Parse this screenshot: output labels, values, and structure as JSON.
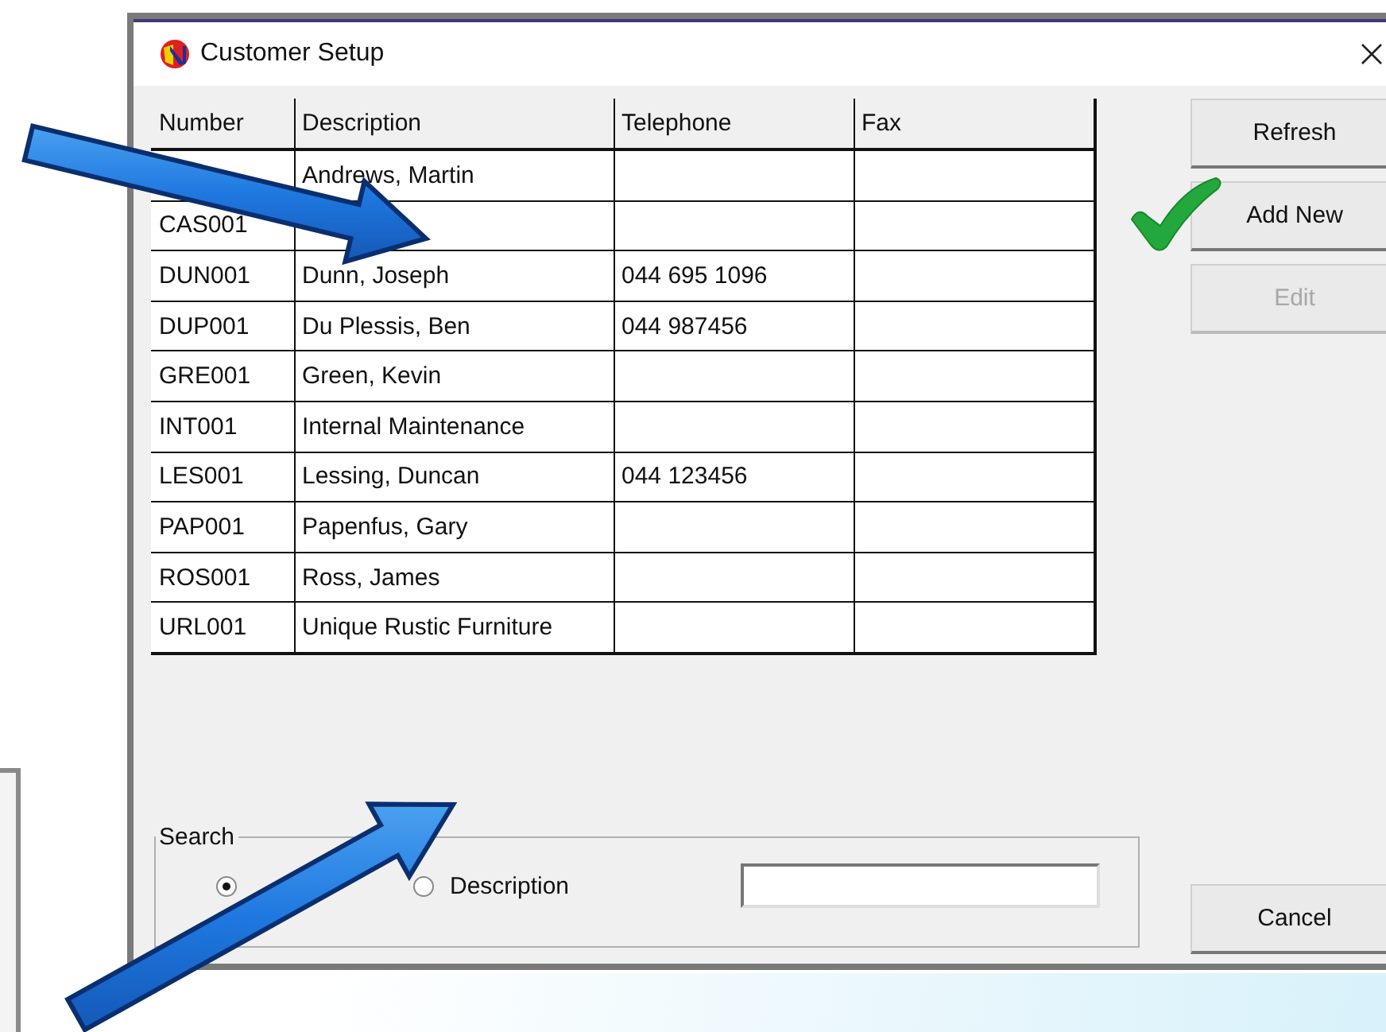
{
  "window": {
    "title": "Customer Setup"
  },
  "table": {
    "columns": [
      "Number",
      "Description",
      "Telephone",
      "Fax"
    ],
    "rows": [
      {
        "description": "Andrews, Martin"
      },
      {
        "number": "CAS001"
      },
      {
        "number": "DUN001",
        "description": "Dunn, Joseph",
        "telephone": "044 695 1096"
      },
      {
        "number": "DUP001",
        "description": "Du Plessis, Ben",
        "telephone": "044 987456"
      },
      {
        "number": "GRE001",
        "description": "Green, Kevin"
      },
      {
        "number": "INT001",
        "description": "Internal Maintenance"
      },
      {
        "number": "LES001",
        "description": "Lessing, Duncan",
        "telephone": "044 123456"
      },
      {
        "number": "PAP001",
        "description": "Papenfus, Gary"
      },
      {
        "number": "ROS001",
        "description": "Ross, James"
      },
      {
        "number": "URL001",
        "description": "Unique Rustic Furniture"
      }
    ]
  },
  "buttons": [
    {
      "label": "Refresh",
      "disabled": false
    },
    {
      "label": "Add New",
      "disabled": false
    },
    {
      "label": "Edit",
      "disabled": true
    }
  ],
  "search": {
    "label": "Search",
    "options": [
      {
        "selected": true
      },
      {
        "label": "Description",
        "selected": false
      }
    ]
  },
  "cancel_button": {
    "label": "Cancel"
  }
}
